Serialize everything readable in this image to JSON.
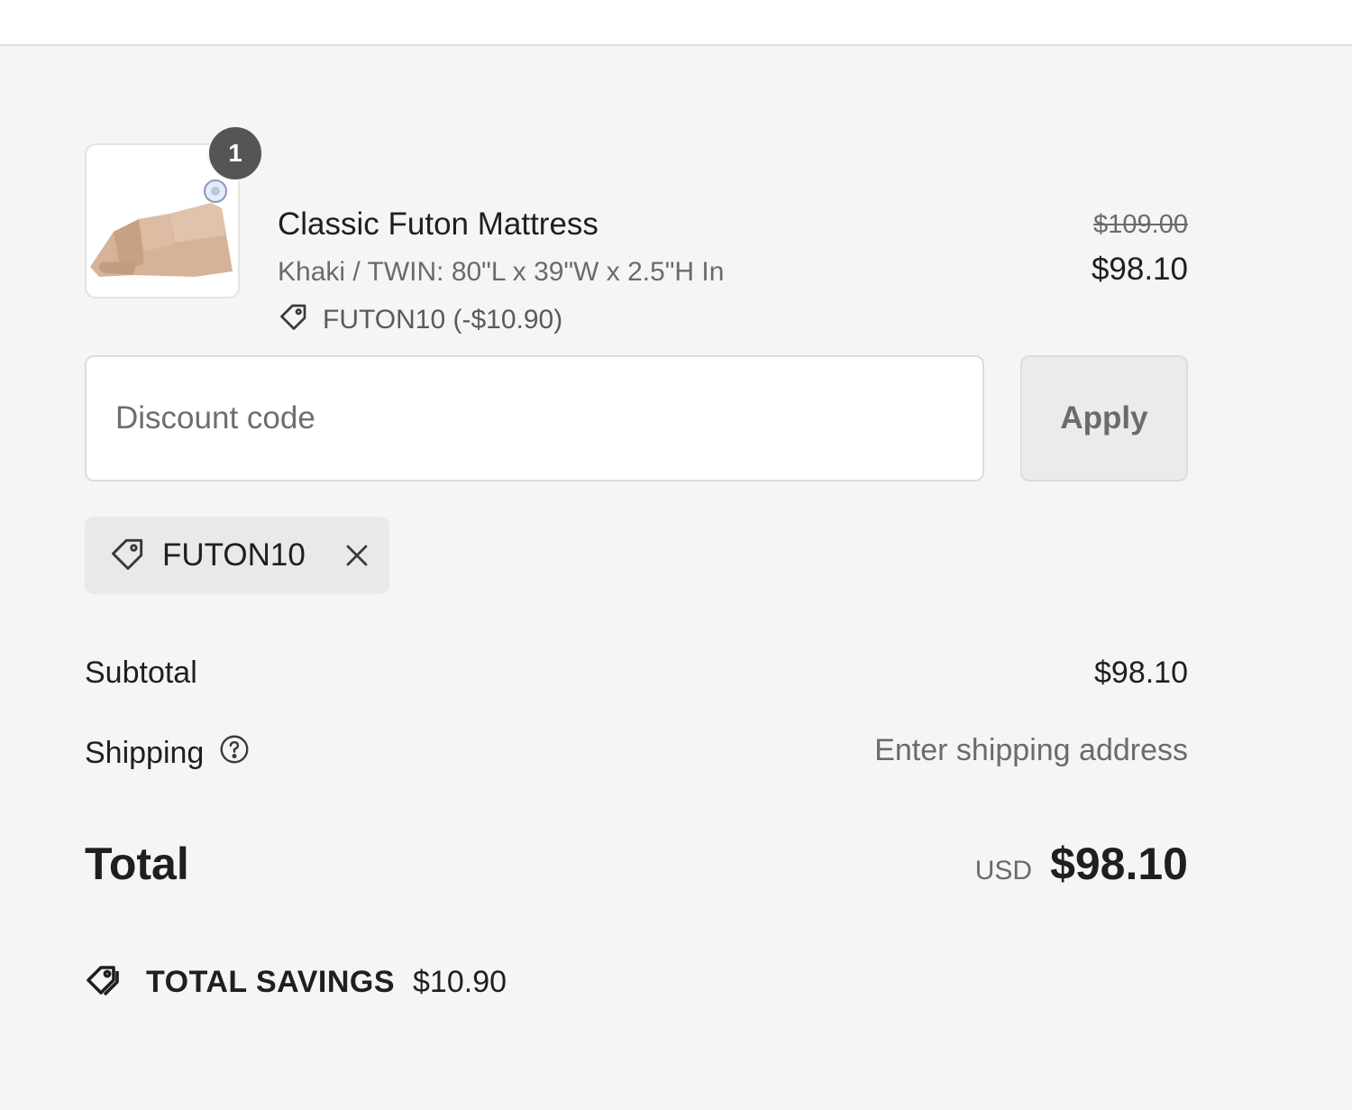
{
  "line_item": {
    "quantity": "1",
    "name": "Classic Futon Mattress",
    "variant": "Khaki / TWIN: 80\"L x 39\"W x 2.5\"H In",
    "discount": "FUTON10 (-$10.90)",
    "price_original": "$109.00",
    "price_current": "$98.10",
    "image_icon": "folded-futon-image"
  },
  "discount": {
    "placeholder": "Discount code",
    "apply_label": "Apply",
    "applied_code": "FUTON10"
  },
  "summary": {
    "subtotal_label": "Subtotal",
    "subtotal_value": "$98.10",
    "shipping_label": "Shipping",
    "shipping_value": "Enter shipping address",
    "total_label": "Total",
    "currency": "USD",
    "total_value": "$98.10",
    "savings_label": "TOTAL SAVINGS",
    "savings_value": "$10.90"
  },
  "colors": {
    "background": "#f5f5f5",
    "badge": "#555555",
    "text": "#1f1f1f",
    "muted": "#6b6b6b"
  }
}
